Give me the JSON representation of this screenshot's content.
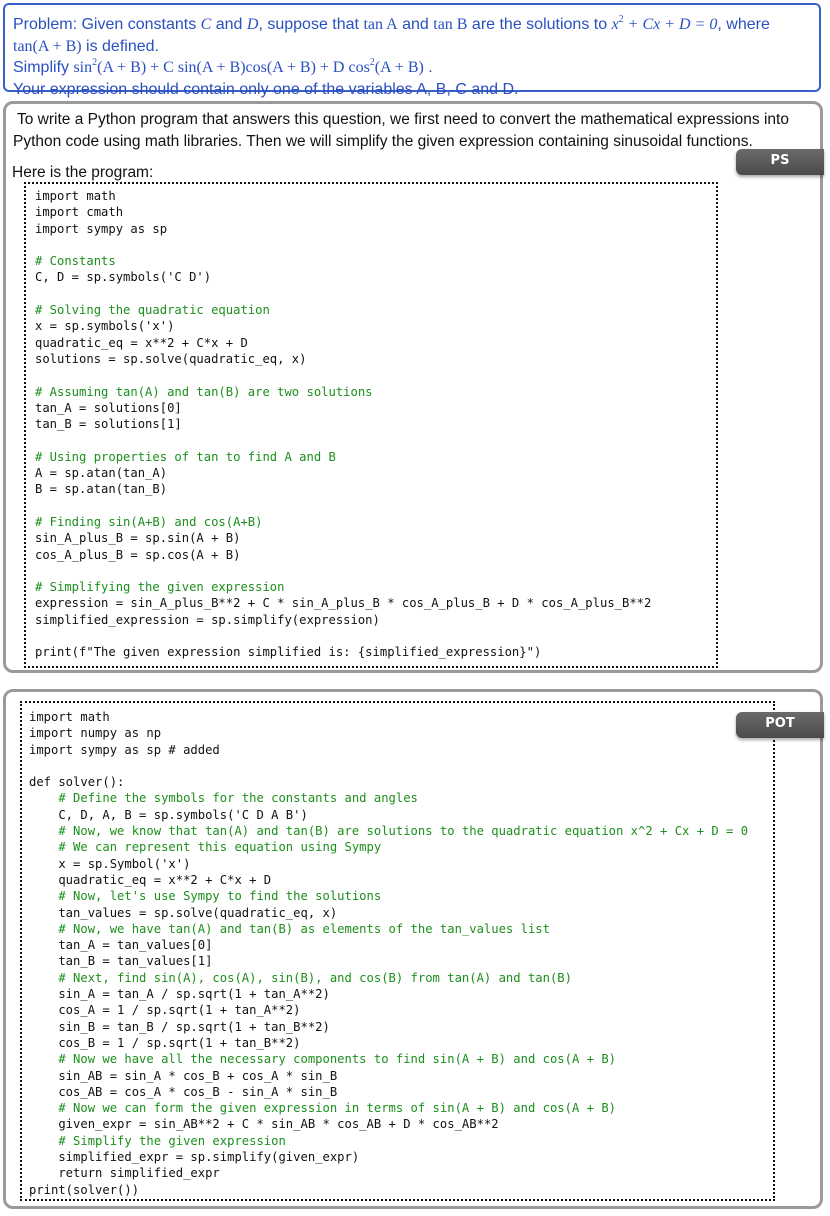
{
  "problem": {
    "line1_a": "Problem: Given constants ",
    "var_c": "C",
    "and_text": " and ",
    "var_d": "D",
    "line1_b": ", suppose that ",
    "tanA": "tan A",
    "and2": " and ",
    "tanB": "tan B",
    "line1_c": " are the solutions to ",
    "eq_x": "x",
    "eq_exp": "2",
    "eq_rest": " + Cx + D = 0",
    "line1_d": ", where",
    "tanAB": "tan(A + B)",
    "line2": " is defined.",
    "simplify_label": "Simplify ",
    "expr_sin": "sin",
    "expr_sq1": "2",
    "expr_mid": "(A + B) + C sin(A + B)cos(A + B) + D cos",
    "expr_sq2": "2",
    "expr_end": "(A + B)",
    "expr_period": " .",
    "line4": "Your expression should contain only one of the variables A, B, C and D."
  },
  "ps_panel": {
    "tag": "PS",
    "prose": "To write a Python program that answers this question, we first need to convert the mathematical expressions into Python code using math libraries. Then we will simplify the given expression containing sinusoidal functions.",
    "intro": "Here is the program:",
    "code": [
      {
        "text": "import math",
        "type": "code"
      },
      {
        "text": "import cmath",
        "type": "code"
      },
      {
        "text": "import sympy as sp",
        "type": "code"
      },
      {
        "text": "",
        "type": "code"
      },
      {
        "text": "# Constants",
        "type": "comment"
      },
      {
        "text": "C, D = sp.symbols('C D')",
        "type": "code"
      },
      {
        "text": "",
        "type": "code"
      },
      {
        "text": "# Solving the quadratic equation",
        "type": "comment"
      },
      {
        "text": "x = sp.symbols('x')",
        "type": "code"
      },
      {
        "text": "quadratic_eq = x**2 + C*x + D",
        "type": "code"
      },
      {
        "text": "solutions = sp.solve(quadratic_eq, x)",
        "type": "code"
      },
      {
        "text": "",
        "type": "code"
      },
      {
        "text": "# Assuming tan(A) and tan(B) are two solutions",
        "type": "comment"
      },
      {
        "text": "tan_A = solutions[0]",
        "type": "code"
      },
      {
        "text": "tan_B = solutions[1]",
        "type": "code"
      },
      {
        "text": "",
        "type": "code"
      },
      {
        "text": "# Using properties of tan to find A and B",
        "type": "comment"
      },
      {
        "text": "A = sp.atan(tan_A)",
        "type": "code"
      },
      {
        "text": "B = sp.atan(tan_B)",
        "type": "code"
      },
      {
        "text": "",
        "type": "code"
      },
      {
        "text": "# Finding sin(A+B) and cos(A+B)",
        "type": "comment"
      },
      {
        "text": "sin_A_plus_B = sp.sin(A + B)",
        "type": "code"
      },
      {
        "text": "cos_A_plus_B = sp.cos(A + B)",
        "type": "code"
      },
      {
        "text": "",
        "type": "code"
      },
      {
        "text": "# Simplifying the given expression",
        "type": "comment"
      },
      {
        "text": "expression = sin_A_plus_B**2 + C * sin_A_plus_B * cos_A_plus_B + D * cos_A_plus_B**2",
        "type": "code"
      },
      {
        "text": "simplified_expression = sp.simplify(expression)",
        "type": "code"
      },
      {
        "text": "",
        "type": "code"
      },
      {
        "text": "print(f\"The given expression simplified is: {simplified_expression}\")",
        "type": "code"
      }
    ]
  },
  "pot_panel": {
    "tag": "POT",
    "code": [
      {
        "text": "import math",
        "type": "code"
      },
      {
        "text": "import numpy as np",
        "type": "code"
      },
      {
        "text": "import sympy as sp # added",
        "type": "code"
      },
      {
        "text": "",
        "type": "code"
      },
      {
        "text": "def solver():",
        "type": "code"
      },
      {
        "text": "    # Define the symbols for the constants and angles",
        "type": "comment"
      },
      {
        "text": "    C, D, A, B = sp.symbols('C D A B')",
        "type": "code"
      },
      {
        "text": "    # Now, we know that tan(A) and tan(B) are solutions to the quadratic equation x^2 + Cx + D = 0",
        "type": "comment"
      },
      {
        "text": "    # We can represent this equation using Sympy",
        "type": "comment"
      },
      {
        "text": "    x = sp.Symbol('x')",
        "type": "code"
      },
      {
        "text": "    quadratic_eq = x**2 + C*x + D",
        "type": "code"
      },
      {
        "text": "    # Now, let's use Sympy to find the solutions",
        "type": "comment"
      },
      {
        "text": "    tan_values = sp.solve(quadratic_eq, x)",
        "type": "code"
      },
      {
        "text": "    # Now, we have tan(A) and tan(B) as elements of the tan_values list",
        "type": "comment"
      },
      {
        "text": "    tan_A = tan_values[0]",
        "type": "code"
      },
      {
        "text": "    tan_B = tan_values[1]",
        "type": "code"
      },
      {
        "text": "    # Next, find sin(A), cos(A), sin(B), and cos(B) from tan(A) and tan(B)",
        "type": "comment"
      },
      {
        "text": "    sin_A = tan_A / sp.sqrt(1 + tan_A**2)",
        "type": "code"
      },
      {
        "text": "    cos_A = 1 / sp.sqrt(1 + tan_A**2)",
        "type": "code"
      },
      {
        "text": "    sin_B = tan_B / sp.sqrt(1 + tan_B**2)",
        "type": "code"
      },
      {
        "text": "    cos_B = 1 / sp.sqrt(1 + tan_B**2)",
        "type": "code"
      },
      {
        "text": "    # Now we have all the necessary components to find sin(A + B) and cos(A + B)",
        "type": "comment"
      },
      {
        "text": "    sin_AB = sin_A * cos_B + cos_A * sin_B",
        "type": "code"
      },
      {
        "text": "    cos_AB = cos_A * cos_B - sin_A * sin_B",
        "type": "code"
      },
      {
        "text": "    # Now we can form the given expression in terms of sin(A + B) and cos(A + B)",
        "type": "comment"
      },
      {
        "text": "    given_expr = sin_AB**2 + C * sin_AB * cos_AB + D * cos_AB**2",
        "type": "code"
      },
      {
        "text": "    # Simplify the given expression",
        "type": "comment"
      },
      {
        "text": "    simplified_expr = sp.simplify(given_expr)",
        "type": "code"
      },
      {
        "text": "    return simplified_expr",
        "type": "code"
      },
      {
        "text": "print(solver())",
        "type": "code"
      }
    ]
  },
  "colors": {
    "problem_blue": "#2a4fc0",
    "comment_green": "#1c8f1c",
    "panel_border": "#9a9a9a",
    "tag_gray": "#5a5a5a"
  }
}
